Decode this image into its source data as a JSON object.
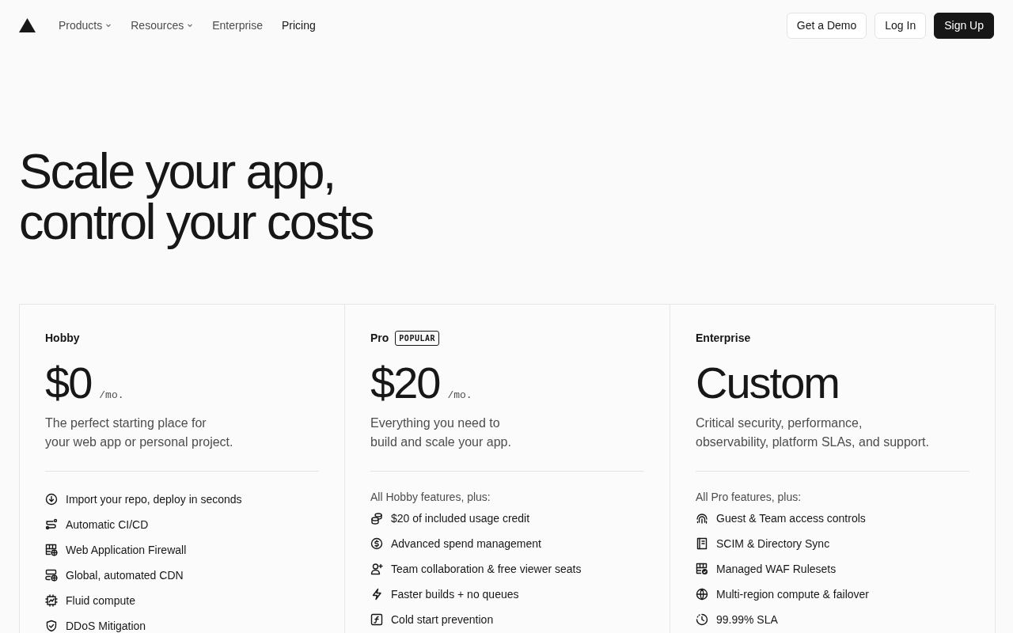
{
  "nav": {
    "links": [
      {
        "label": "Products",
        "dropdown": true,
        "selected": false
      },
      {
        "label": "Resources",
        "dropdown": true,
        "selected": false
      },
      {
        "label": "Enterprise",
        "dropdown": false,
        "selected": false
      },
      {
        "label": "Pricing",
        "dropdown": false,
        "selected": true
      }
    ],
    "buttons": [
      {
        "label": "Get a Demo",
        "kind": "outline"
      },
      {
        "label": "Log In",
        "kind": "outline"
      },
      {
        "label": "Sign Up",
        "kind": "primary"
      }
    ]
  },
  "heading": [
    "Scale your app,",
    "control your costs"
  ],
  "plans": [
    {
      "name": "Hobby",
      "price": "$0",
      "period": "/mo.",
      "description": [
        "The perfect starting place for",
        "your web app or personal project."
      ],
      "features": [
        "Import your repo, deploy in seconds",
        "Automatic CI/CD",
        "Web Application Firewall",
        "Global, automated CDN",
        "Fluid compute",
        "DDoS Mitigation"
      ]
    },
    {
      "name": "Pro",
      "badge": "POPULAR",
      "price": "$20",
      "period": "/mo.",
      "description": [
        "Everything you need to",
        "build and scale your app."
      ],
      "features_intro": "All Hobby features, plus:",
      "features": [
        "$20 of included usage credit",
        "Advanced spend management",
        "Team collaboration & free viewer seats",
        "Faster builds + no queues",
        "Cold start prevention"
      ]
    },
    {
      "name": "Enterprise",
      "price": "Custom",
      "description": [
        "Critical security, performance,",
        "observability, platform SLAs, and support."
      ],
      "features_intro": "All Pro features, plus:",
      "features": [
        "Guest & Team access controls",
        "SCIM & Directory Sync",
        "Managed WAF Rulesets",
        "Multi-region compute & failover",
        "99.99% SLA"
      ]
    }
  ]
}
